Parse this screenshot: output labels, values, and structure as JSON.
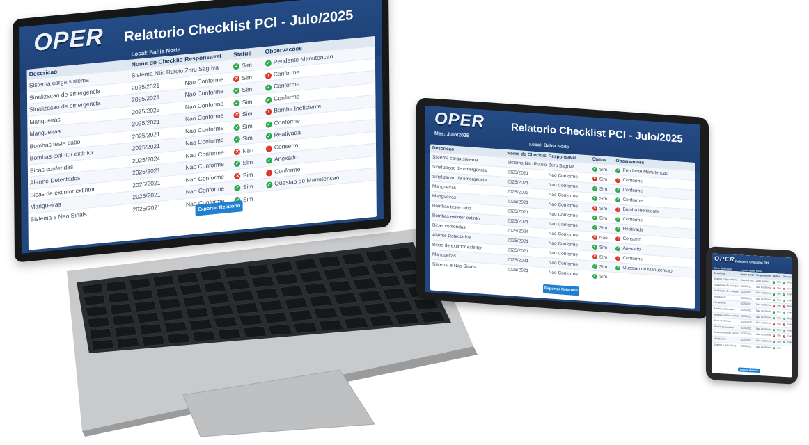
{
  "title": "Relatorio Checklist PCI - Julo/2025",
  "logo": "OPER",
  "meta_left": "Mes: Julo/2025",
  "meta_center": "Local: Bahia Norte",
  "columns": [
    "Descricao",
    "Nome do Checklist",
    "Responsavel",
    "Status",
    "Observacoes"
  ],
  "rows": [
    {
      "c0": "Sistema carga sistema",
      "c1": "Sistema Ntic Rutoio",
      "c2": "Zoru Sagriva",
      "status": "ok",
      "s": "Sim",
      "obs": "Pendente Manutencao"
    },
    {
      "c0": "Sinalizacao de emergencia",
      "c1": "2025/2021",
      "c2": "Nao Conforme",
      "status": "nc",
      "s": "Sim",
      "obs": "Conforme"
    },
    {
      "c0": "Sinalizacao de emergencia",
      "c1": "2025/2021",
      "c2": "Nao Conforme",
      "status": "ok",
      "s": "Sim",
      "obs": "Conforme"
    },
    {
      "c0": "Mangueiras",
      "c1": "2025/2023",
      "c2": "Nao Conforme",
      "status": "ok",
      "s": "Sim",
      "obs": "Conforme"
    },
    {
      "c0": "Mangueiras",
      "c1": "2025/2021",
      "c2": "Nao Conforme",
      "status": "nc",
      "s": "Sim",
      "obs": "Bomba Ineficiente"
    },
    {
      "c0": "Bombas teste cabo",
      "c1": "2025/2021",
      "c2": "Nao Conforme",
      "status": "ok",
      "s": "Sim",
      "obs": "Conforme"
    },
    {
      "c0": "Bombas extintor extintor",
      "c1": "2025/2021",
      "c2": "Nao Conforme",
      "status": "ok",
      "s": "Sim",
      "obs": "Reativada"
    },
    {
      "c0": "Bicas conferidas",
      "c1": "2025/2024",
      "c2": "Nao Conforme",
      "status": "nc",
      "s": "Nao",
      "obs": "Conserto"
    },
    {
      "c0": "Alarme Detectados",
      "c1": "2025/2021",
      "c2": "Nao Conforme",
      "status": "ok",
      "s": "Sim",
      "obs": "Anexado"
    },
    {
      "c0": "Bicas de extintor extintor",
      "c1": "2025/2021",
      "c2": "Nao Conforme",
      "status": "nc",
      "s": "Sim",
      "obs": "Conforme"
    },
    {
      "c0": "Mangueiras",
      "c1": "2025/2021",
      "c2": "Nao Conforme",
      "status": "ok",
      "s": "Sim",
      "obs": "Questao de Manutencao"
    },
    {
      "c0": "Sistema e Nao Sinais",
      "c1": "2025/2021",
      "c2": "Nao Conforme",
      "status": "ok",
      "s": "Sim",
      "obs": ""
    }
  ],
  "button_label": "Exportar Relatorio",
  "phone_title": "Relatorio Checklist PCI",
  "colors": {
    "brand": "#22477f",
    "ok": "#2fa84f",
    "nc": "#d8382c",
    "button": "#1f80cf"
  }
}
